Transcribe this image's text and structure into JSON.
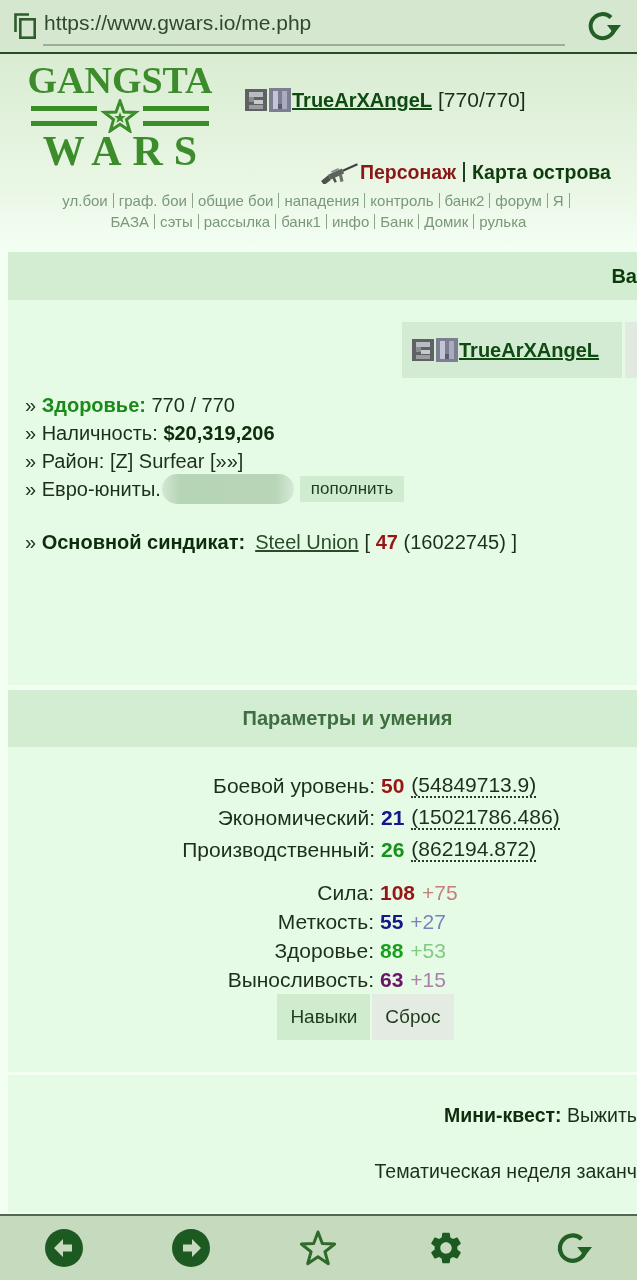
{
  "browser": {
    "url": "https://www.gwars.io/me.php"
  },
  "header": {
    "logo": {
      "top": "GANGSTA",
      "bottom": "WARS"
    },
    "player": {
      "name": "TrueArXAngeL",
      "hp": "[770/770]"
    },
    "menu": [
      {
        "label": "Персонаж",
        "selected": true
      },
      {
        "label": "Карта острова",
        "selected": false
      }
    ],
    "nav_rows": [
      [
        "ул.бои",
        "граф. бои",
        "общие бои",
        "нападения",
        "контроль",
        "банк2",
        "форум",
        "Я"
      ],
      [
        "БАЗА",
        "сэты",
        "рассылка",
        "банк1",
        "инфо",
        "Банк",
        "Домик",
        "рулька"
      ]
    ]
  },
  "profile_panel": {
    "title": "Ва",
    "tab": {
      "label": "TrueArXAngeL"
    },
    "lines": [
      {
        "kind": "health",
        "text": "» **Здоровье:** 770 / 770"
      },
      {
        "kind": "money",
        "text": "» Наличность: **$20,319,206**"
      },
      {
        "kind": "plain",
        "text": "» Район: [Z] Surfear [»»]"
      },
      {
        "kind": "balance",
        "text": "» Евро-юниты.",
        "redacted": true,
        "button": "пополнить"
      }
    ],
    "syndicate": {
      "label": "» **Основной синдикат:**",
      "name": "Steel Union",
      "rank": "[ **47** (16022745) ]"
    }
  },
  "skills_panel": {
    "title": "Параметры и умения",
    "levels": [
      {
        "label": "Боевой уровень:",
        "value": "50",
        "exp": "(54849713.9)",
        "color": "#9a1414"
      },
      {
        "label": "Экономический:",
        "value": "21",
        "exp": "(15021786.486)",
        "color": "#16168c"
      },
      {
        "label": "Производственный:",
        "value": "26",
        "exp": "(862194.872)",
        "color": "#18901c"
      }
    ],
    "stats": [
      {
        "label": "Сила:",
        "value": "108",
        "bonus": "+75",
        "color": "#9a1414"
      },
      {
        "label": "Меткость:",
        "value": "55",
        "bonus": "+27",
        "color": "#16168c"
      },
      {
        "label": "Здоровье:",
        "value": "88",
        "bonus": "+53",
        "color": "#18a01c"
      },
      {
        "label": "Выносливость:",
        "value": "63",
        "bonus": "+15",
        "color": "#6a1468"
      }
    ],
    "buttons": [
      {
        "label": "Навыки",
        "selected": true
      },
      {
        "label": "Сброс",
        "selected": false
      }
    ]
  },
  "quest_panel": {
    "quest": "**Мини-квест:** Выжить",
    "notice": "Тематическая неделя заканч"
  }
}
